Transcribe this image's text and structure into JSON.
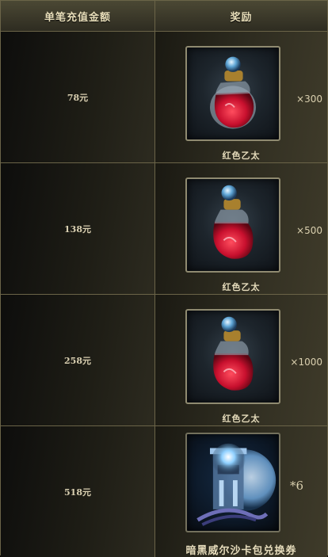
{
  "header": {
    "amount_label": "单笔充值金额",
    "reward_label": "奖励"
  },
  "rows": [
    {
      "amount": "78元",
      "item_name": "红色乙太",
      "quantity": "×300",
      "icon": "red-potion-icon"
    },
    {
      "amount": "138元",
      "item_name": "红色乙太",
      "quantity": "×500",
      "icon": "red-potion-icon"
    },
    {
      "amount": "258元",
      "item_name": "红色乙太",
      "quantity": "×1000",
      "icon": "red-potion-icon"
    },
    {
      "amount": "518元",
      "item_name": "暗黑威尔沙卡包兑换券",
      "quantity": "*6",
      "icon": "card-pack-icon"
    }
  ],
  "colors": {
    "border": "#6b6448",
    "text": "#e6dcbc",
    "potion_red": "#c8102e"
  }
}
